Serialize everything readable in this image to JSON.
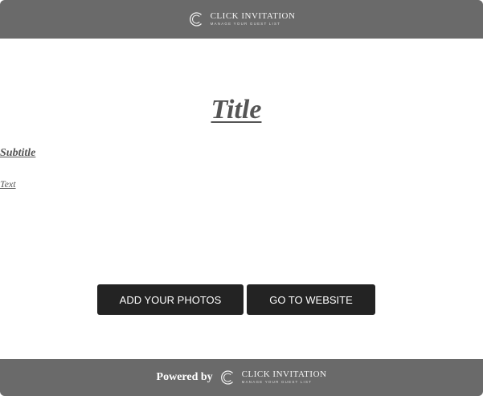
{
  "header": {
    "logo": {
      "name": "CLICK INVITATION",
      "tagline": "MANAGE YOUR GUEST LIST"
    }
  },
  "content": {
    "title": "Title",
    "subtitle": "Subtitle",
    "text": "Text"
  },
  "actions": {
    "add_photos_label": "ADD YOUR PHOTOS",
    "website_label": "GO TO WEBSITE"
  },
  "footer": {
    "powered_by": "Powered by",
    "logo": {
      "name": "CLICK INVITATION",
      "tagline": "MANAGE YOUR GUEST LIST"
    }
  },
  "colors": {
    "bar": "#6a6a6a",
    "button": "#232323",
    "text": "#555555"
  },
  "icons": {
    "logo": "click-invitation-logo-icon"
  }
}
